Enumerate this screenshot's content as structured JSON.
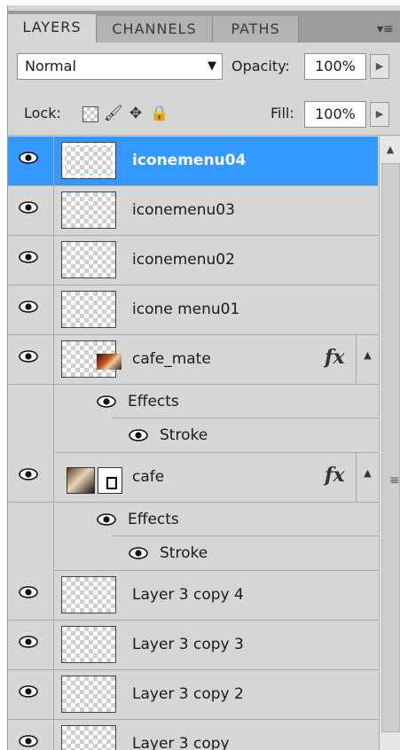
{
  "tabs": [
    {
      "label": "LAYERS",
      "active": true
    },
    {
      "label": "CHANNELS",
      "active": false
    },
    {
      "label": "PATHS",
      "active": false
    }
  ],
  "panel_menu_icon": "panel-menu-icon",
  "blend": {
    "mode": "Normal",
    "opacity_label": "Opacity:",
    "opacity": "100%"
  },
  "lock": {
    "label": "Lock:",
    "fill_label": "Fill:",
    "fill": "100%"
  },
  "layers": [
    {
      "name": "iconemenu04",
      "selected": true
    },
    {
      "name": "iconemenu03"
    },
    {
      "name": "iconemenu02"
    },
    {
      "name": "icone menu01"
    },
    {
      "name": "cafe_mate",
      "fx": "fx",
      "effects_label": "Effects",
      "effect": "Stroke"
    },
    {
      "name": "cafe",
      "fx": "fx",
      "effects_label": "Effects",
      "effect": "Stroke"
    },
    {
      "name": "Layer 3 copy 4"
    },
    {
      "name": "Layer 3 copy 3"
    },
    {
      "name": "Layer 3 copy 2"
    },
    {
      "name": "Layer 3 copy"
    }
  ],
  "colors": {
    "panel": "#d6d6d6",
    "selected": "#3399ff",
    "tab_bar": "#9c9c9c"
  }
}
